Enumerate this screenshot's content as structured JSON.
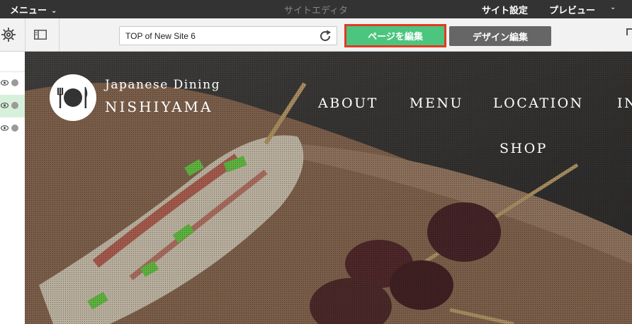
{
  "topbar": {
    "menu_label": "メニュー",
    "title": "サイトエディタ",
    "site_settings_label": "サイト設定",
    "preview_label": "プレビュー"
  },
  "toolbar": {
    "url_value": "TOP of New Site 6",
    "edit_page_label": "ページを編集",
    "edit_design_label": "デザイン編集"
  },
  "site": {
    "brand_line1": "Japanese Dining",
    "brand_line2": "NISHIYAMA",
    "nav": [
      "ABOUT",
      "MENU",
      "LOCATION",
      "IN",
      "SHOP"
    ]
  },
  "colors": {
    "topbar_bg": "#333333",
    "edit_page_bg": "#4cc57f",
    "edit_page_highlight": "#e23a22",
    "edit_design_bg": "#666666",
    "layer_active_bg": "#d7f0dc"
  },
  "icons": [
    "chevron-down-icon",
    "gear-icon",
    "panel-toggle-icon",
    "reload-icon",
    "eye-icon",
    "status-dot-icon",
    "plate-utensils-logo-icon"
  ]
}
